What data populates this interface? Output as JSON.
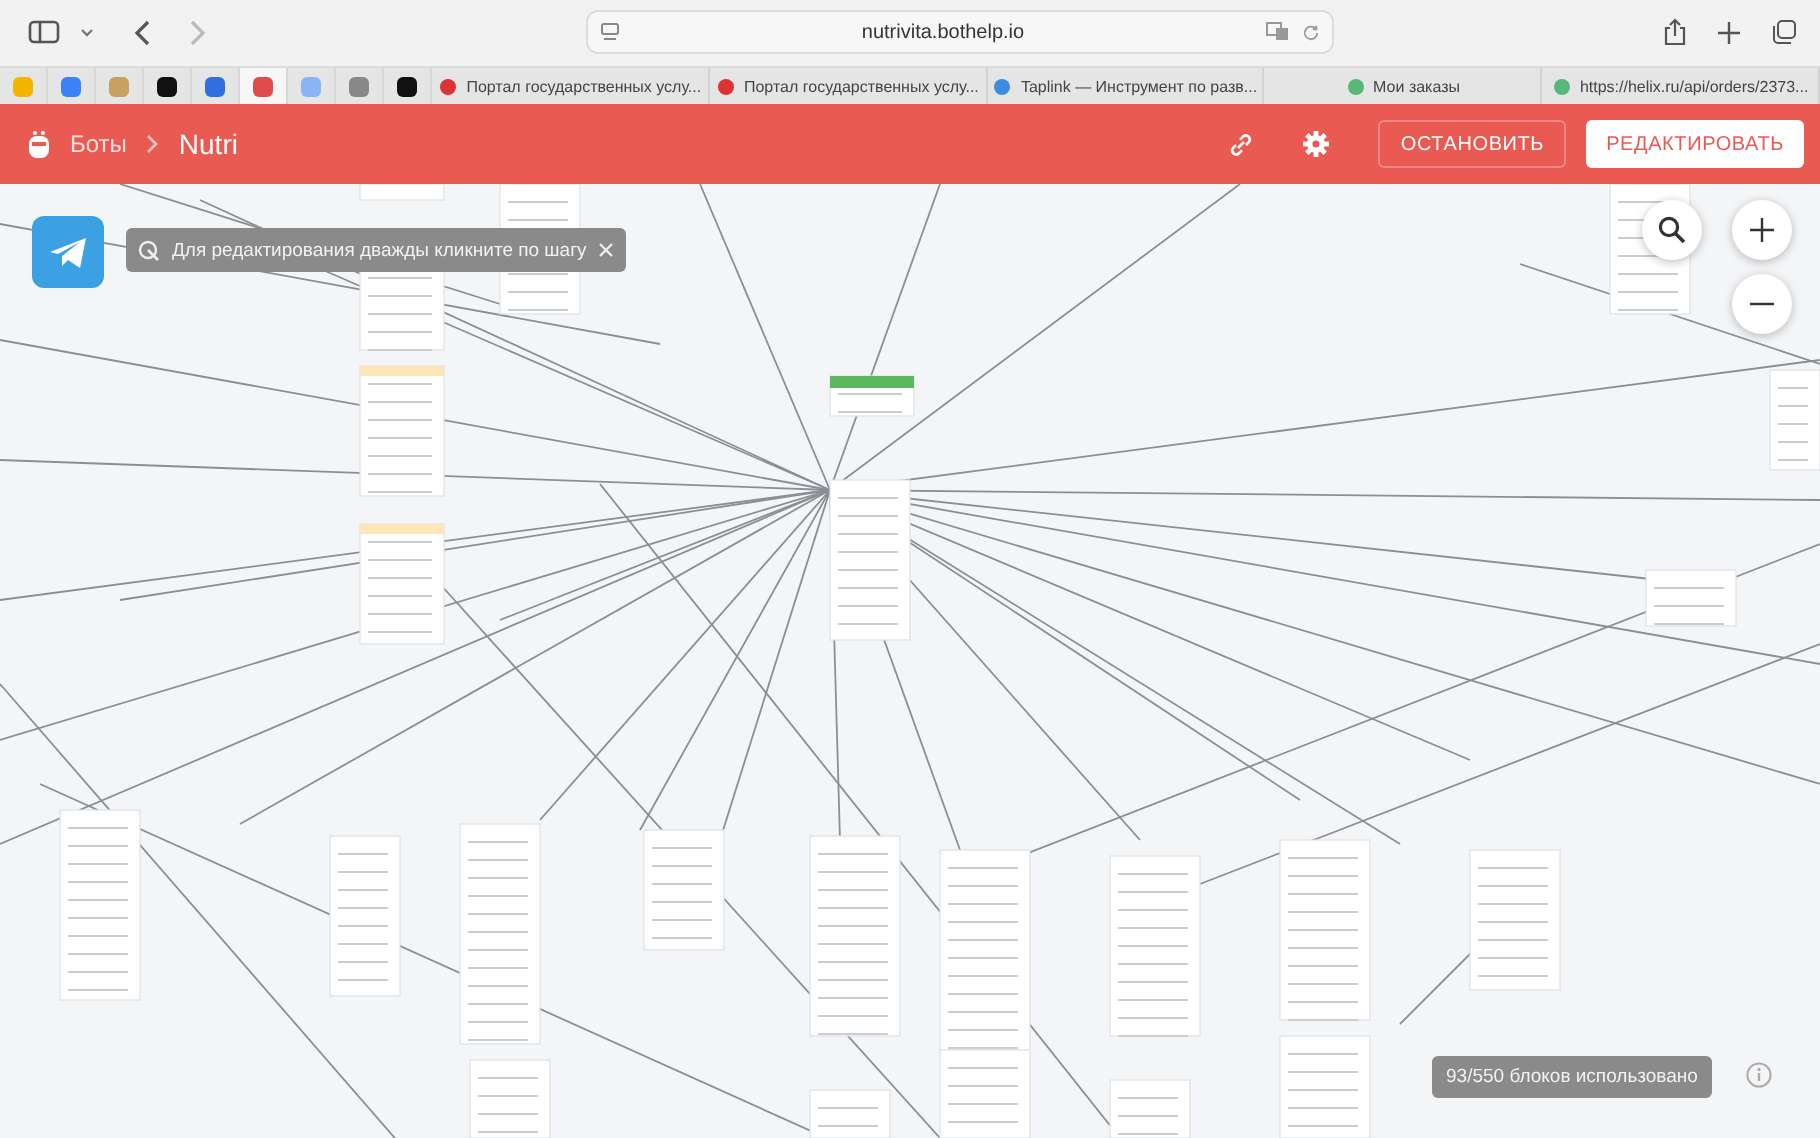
{
  "browser": {
    "url": "nutrivita.bothelp.io",
    "pinned_tabs": [
      {
        "selected": false
      },
      {
        "selected": false
      },
      {
        "selected": false
      },
      {
        "selected": false
      },
      {
        "selected": false
      },
      {
        "selected": true
      },
      {
        "selected": false
      },
      {
        "selected": false
      },
      {
        "selected": false
      }
    ],
    "tabs": [
      {
        "title": "Портал государственных услу...",
        "selected": false
      },
      {
        "title": "Портал государственных услу...",
        "selected": false
      },
      {
        "title": "Taplink — Инструмент по разв...",
        "selected": false
      },
      {
        "title": "Мои заказы",
        "selected": false
      },
      {
        "title": "https://helix.ru/api/orders/2373...",
        "selected": false
      }
    ]
  },
  "header": {
    "breadcrumb": [
      "Боты",
      "Nutri"
    ],
    "buttons": [
      {
        "label": "ОСТАНОВИТЬ",
        "kind": "outline"
      },
      {
        "label": "РЕДАКТИРОВАТЬ",
        "kind": "filled"
      }
    ]
  },
  "hint": "Для редактирования дважды кликните по шагу",
  "usage": "93/550 блоков использовано"
}
